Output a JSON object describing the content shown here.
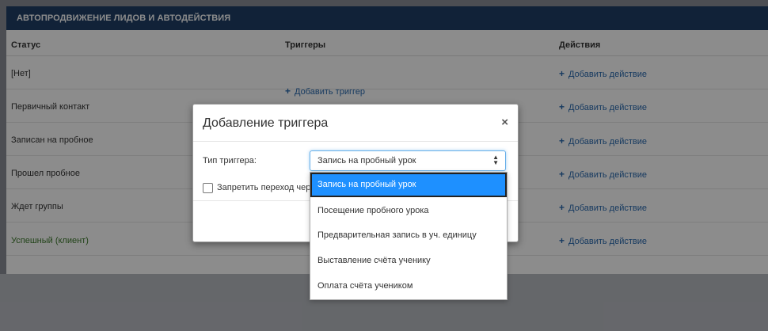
{
  "panel": {
    "title": "АВТОПРОДВИЖЕНИЕ ЛИДОВ И АВТОДЕЙСТВИЯ",
    "columns": {
      "status": "Статус",
      "triggers": "Триггеры",
      "actions": "Действия"
    },
    "add_trigger_label": "Добавить триггер",
    "add_action_label": "Добавить действие",
    "rows": [
      {
        "status": "[Нет]"
      },
      {
        "status": "Первичный контакт"
      },
      {
        "status": "Записан на пробное"
      },
      {
        "status": "Прошел пробное"
      },
      {
        "status": "Ждет группы"
      },
      {
        "status": "Успешный (клиент)"
      }
    ],
    "colors": {
      "header_bg": "#1f3f66",
      "link": "#2a6ab0",
      "success_text": "#3d7a2c"
    }
  },
  "modal": {
    "title": "Добавление триггера",
    "close_glyph": "×",
    "trigger_type_label": "Тип триггера:",
    "trigger_type_value": "Запись на пробный урок",
    "checkbox_label": "Запретить переход через",
    "options": [
      "Запись на пробный урок",
      "Посещение пробного урока",
      "Предварительная запись в уч. единицу",
      "Выставление счёта ученику",
      "Оплата счёта учеником"
    ],
    "selected_option_index": 0,
    "colors": {
      "selected_bg": "#1e90ff"
    }
  }
}
